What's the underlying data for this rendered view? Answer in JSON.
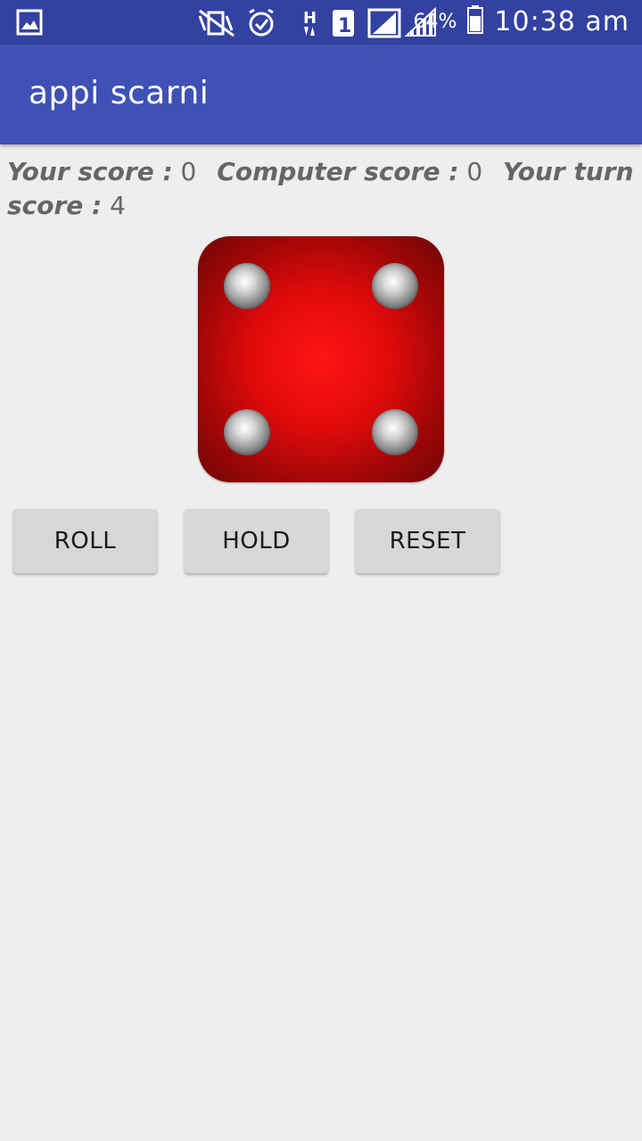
{
  "status_bar": {
    "battery_percent": "64%",
    "time": "10:38 am",
    "sim_slot": "1",
    "network_type": "H",
    "icons": [
      "gallery-icon",
      "vibrate-icon",
      "alarm-icon",
      "data-arrows-icon",
      "sim-icon",
      "signal-icon",
      "signal-icon",
      "battery-icon"
    ]
  },
  "app_bar": {
    "title": "appi scarni",
    "color": "#3f51b5"
  },
  "scores": {
    "your_label": "Your score :",
    "your_value": "0",
    "computer_label": "Computer score :",
    "computer_value": "0",
    "turn_label": "Your turn score :",
    "turn_value": "4"
  },
  "die": {
    "face": 4,
    "color": "#ee1111"
  },
  "buttons": {
    "roll": "ROLL",
    "hold": "HOLD",
    "reset": "RESET"
  }
}
